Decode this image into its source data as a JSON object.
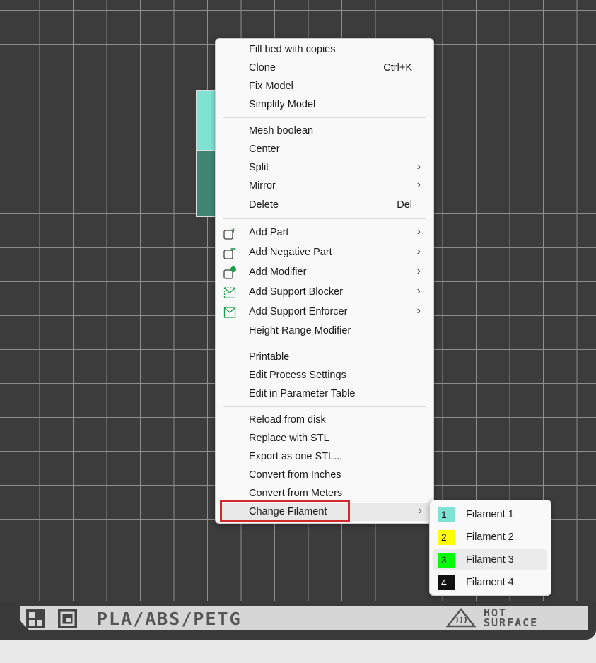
{
  "context_menu": {
    "items": [
      {
        "label": "Fill bed with copies"
      },
      {
        "label": "Clone",
        "shortcut": "Ctrl+K"
      },
      {
        "label": "Fix Model"
      },
      {
        "label": "Simplify Model"
      },
      {
        "label": "Mesh boolean"
      },
      {
        "label": "Center"
      },
      {
        "label": "Split",
        "submenu": true
      },
      {
        "label": "Mirror",
        "submenu": true
      },
      {
        "label": "Delete",
        "shortcut": "Del"
      },
      {
        "label": "Add Part",
        "icon": "add-part-icon",
        "submenu": true
      },
      {
        "label": "Add Negative Part",
        "icon": "add-negative-part-icon",
        "submenu": true
      },
      {
        "label": "Add Modifier",
        "icon": "add-modifier-icon",
        "submenu": true
      },
      {
        "label": "Add Support Blocker",
        "icon": "support-blocker-icon",
        "submenu": true
      },
      {
        "label": "Add Support Enforcer",
        "icon": "support-enforcer-icon",
        "submenu": true
      },
      {
        "label": "Height Range Modifier"
      },
      {
        "label": "Printable"
      },
      {
        "label": "Edit Process Settings"
      },
      {
        "label": "Edit in Parameter Table"
      },
      {
        "label": "Reload from disk"
      },
      {
        "label": "Replace with STL"
      },
      {
        "label": "Export as one STL..."
      },
      {
        "label": "Convert from Inches"
      },
      {
        "label": "Convert from Meters"
      },
      {
        "label": "Change Filament",
        "submenu": true,
        "highlighted": true
      }
    ],
    "arrow_glyph": "›"
  },
  "filament_submenu": {
    "items": [
      {
        "number": "1",
        "label": "Filament 1",
        "color": "#7fe3d4",
        "text_color": "#1a1a1a"
      },
      {
        "number": "2",
        "label": "Filament 2",
        "color": "#ffff00",
        "text_color": "#1a1a1a"
      },
      {
        "number": "3",
        "label": "Filament 3",
        "color": "#00ff00",
        "text_color": "#1a1a1a",
        "hovered": true
      },
      {
        "number": "4",
        "label": "Filament 4",
        "color": "#111111",
        "text_color": "#ffffff"
      }
    ]
  },
  "build_plate": {
    "material_text": "PLA/ABS/PETG",
    "hot_surface_line1": "HOT",
    "hot_surface_line2": "SURFACE"
  },
  "colors": {
    "highlight_box": "#d12a2a",
    "plate": "#3c3c3c",
    "grid_line": "#8d8d8d",
    "accent_green": "#1f9a4a"
  }
}
